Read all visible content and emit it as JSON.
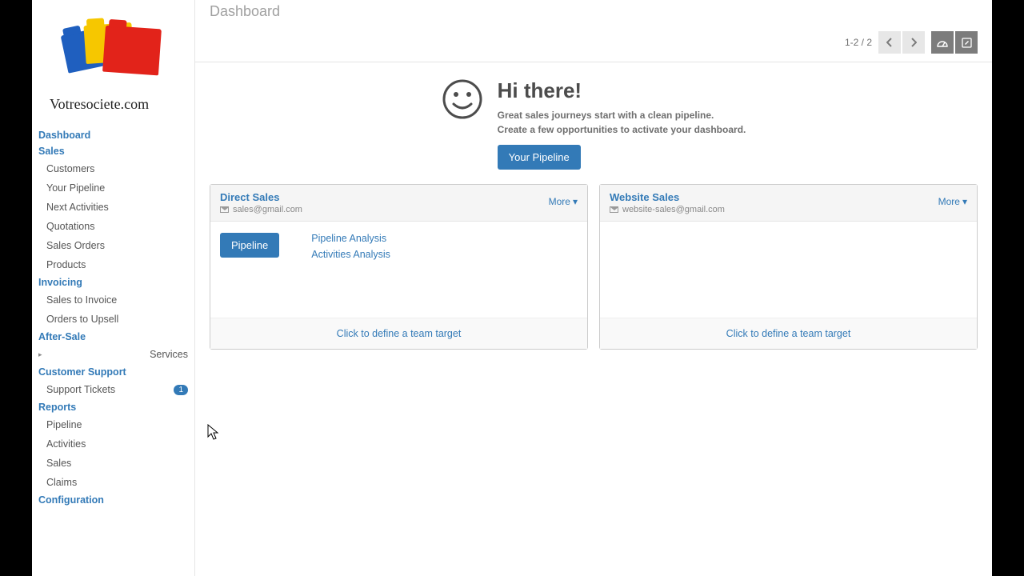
{
  "logo_text": "Votresociete.com",
  "page_title": "Dashboard",
  "pager": {
    "text": "1-2 / 2"
  },
  "nav": {
    "dashboard": "Dashboard",
    "sales": "Sales",
    "sales_items": {
      "customers": "Customers",
      "your_pipeline": "Your Pipeline",
      "next_activities": "Next Activities",
      "quotations": "Quotations",
      "sales_orders": "Sales Orders",
      "products": "Products"
    },
    "invoicing": "Invoicing",
    "invoicing_items": {
      "sales_to_invoice": "Sales to Invoice",
      "orders_to_upsell": "Orders to Upsell"
    },
    "after_sale": "After-Sale",
    "after_sale_items": {
      "services": "Services"
    },
    "customer_support": "Customer Support",
    "customer_support_items": {
      "support_tickets": "Support Tickets"
    },
    "support_tickets_badge": "1",
    "reports": "Reports",
    "reports_items": {
      "pipeline": "Pipeline",
      "activities": "Activities",
      "sales": "Sales",
      "claims": "Claims"
    },
    "configuration": "Configuration"
  },
  "welcome": {
    "title": "Hi there!",
    "line1": "Great sales journeys start with a clean pipeline.",
    "line2": "Create a few opportunities to activate your dashboard.",
    "button": "Your Pipeline"
  },
  "cards": [
    {
      "title": "Direct Sales",
      "email": "sales@gmail.com",
      "more": "More",
      "pipeline_button": "Pipeline",
      "links": {
        "pipeline_analysis": "Pipeline Analysis",
        "activities_analysis": "Activities Analysis"
      },
      "footer": "Click to define a team target"
    },
    {
      "title": "Website Sales",
      "email": "website-sales@gmail.com",
      "more": "More",
      "footer": "Click to define a team target"
    }
  ]
}
